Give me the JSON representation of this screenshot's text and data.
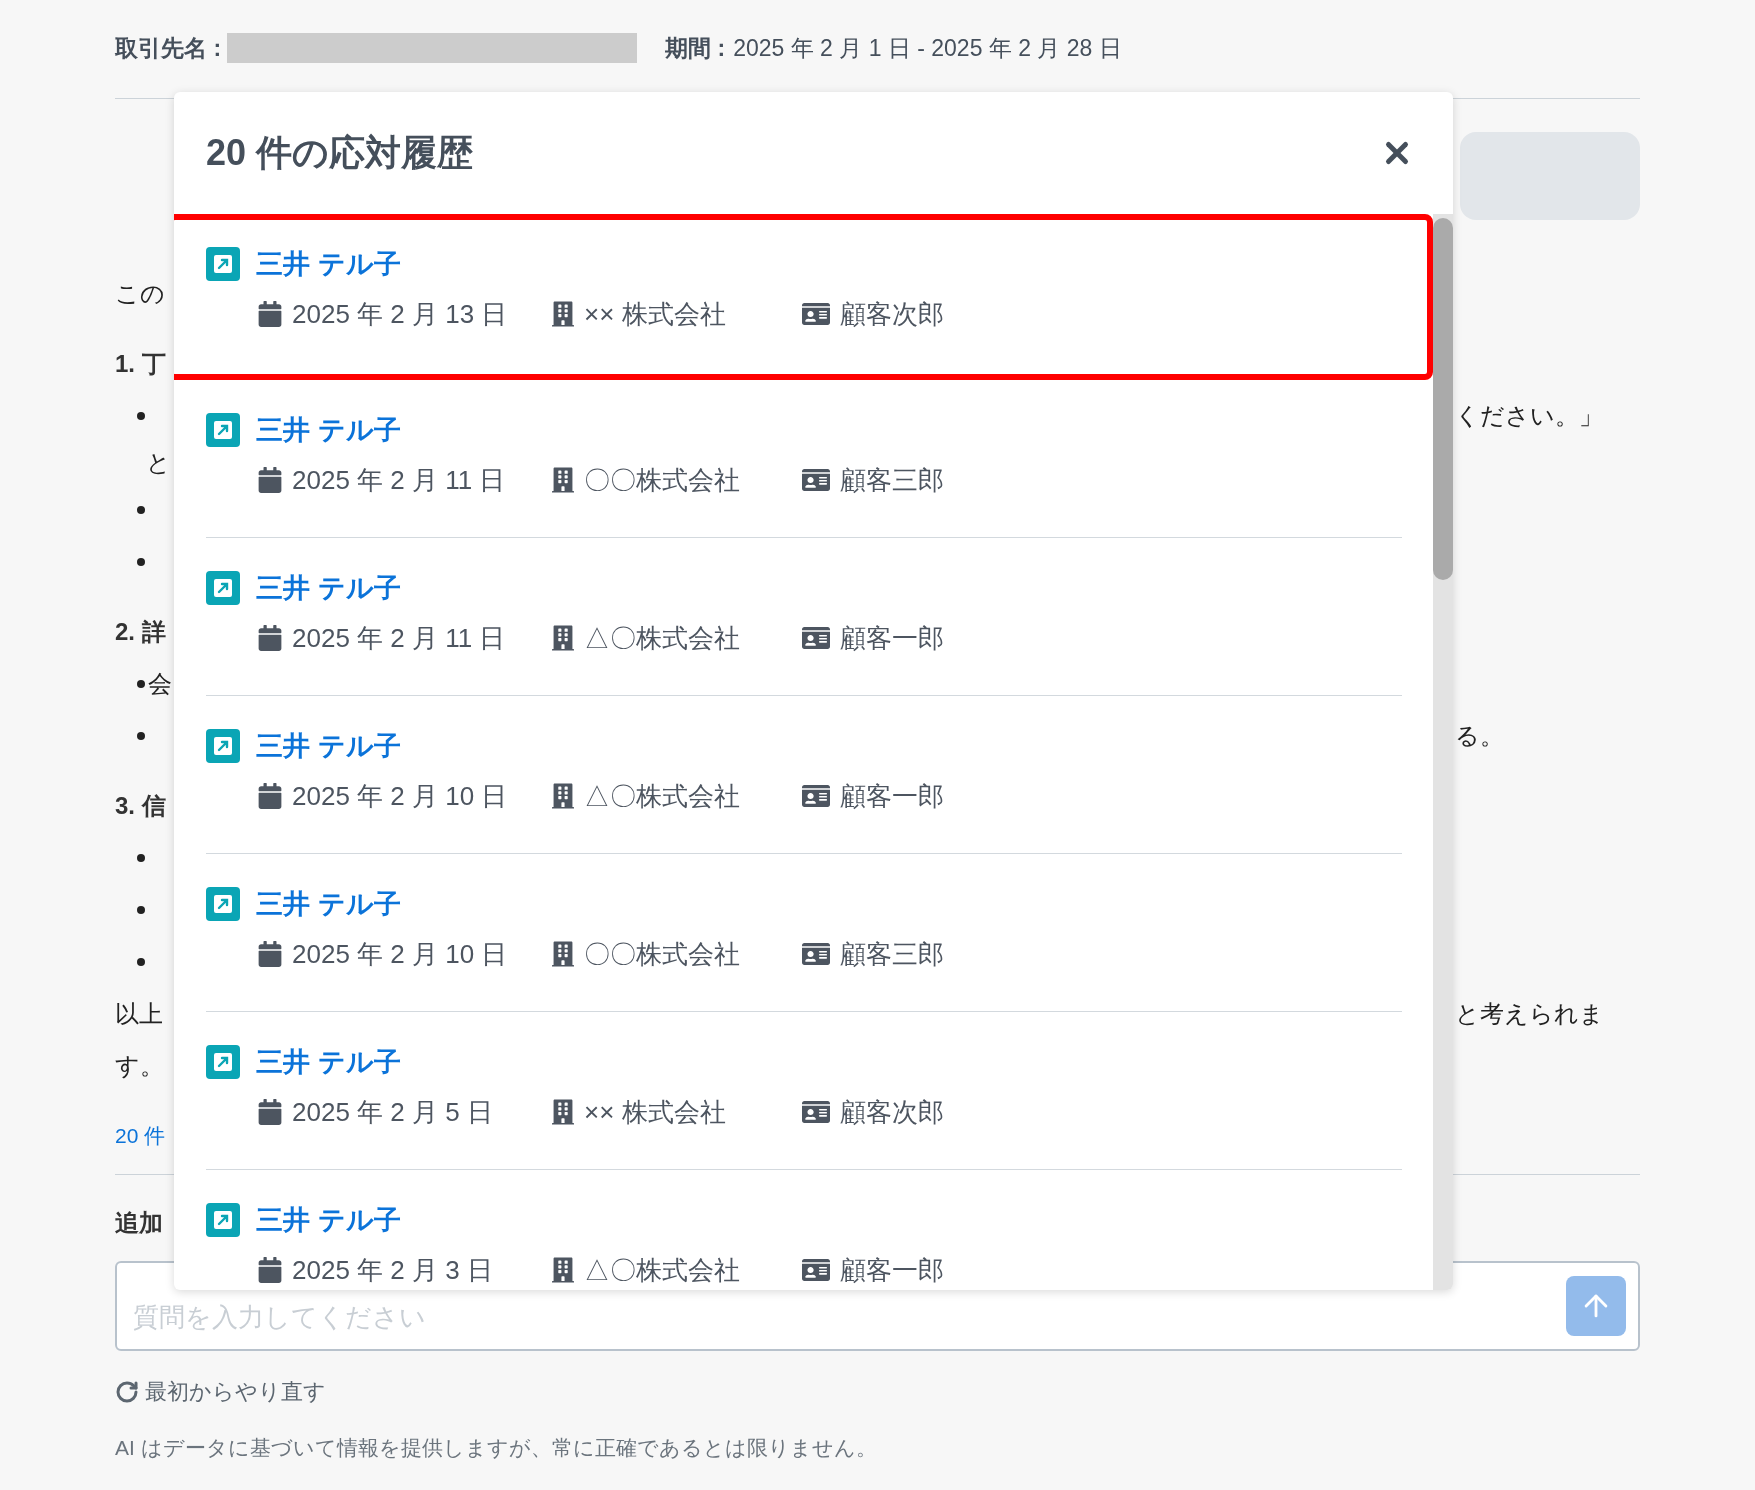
{
  "header": {
    "client_label": "取引先名 :",
    "period_label": "期間 :",
    "period_value": "2025 年 2 月 1 日 - 2025 年 2 月 28 日"
  },
  "fragments": [
    {
      "kind": "text",
      "left": "この"
    },
    {
      "kind": "heading",
      "left": "1. 丁"
    },
    {
      "kind": "bullet",
      "right": "ください。」"
    },
    {
      "kind": "continuation",
      "left": "と"
    },
    {
      "kind": "bullet"
    },
    {
      "kind": "bullet"
    },
    {
      "kind": "heading",
      "left": "2. 詳"
    },
    {
      "kind": "bullet",
      "left": "会"
    },
    {
      "kind": "bullet",
      "right": "る。"
    },
    {
      "kind": "heading",
      "left": "3. 信"
    },
    {
      "kind": "bullet"
    },
    {
      "kind": "bullet"
    },
    {
      "kind": "bullet"
    },
    {
      "kind": "text",
      "left": "以上",
      "right": "と考えられま"
    },
    {
      "kind": "text",
      "left": "す。"
    },
    {
      "kind": "link",
      "left": "20 件"
    }
  ],
  "follow_up": {
    "label": "追加",
    "placeholder": "質問を入力してください"
  },
  "reset": "最初からやり直す",
  "disclaimer": "AI はデータに基づいて情報を提供しますが、常に正確であるとは限りません。",
  "modal": {
    "title": "20 件の応対履歴",
    "items": [
      {
        "name": "三井 テル子",
        "date": "2025 年 2 月 13 日",
        "company": "×× 株式会社",
        "contact": "顧客次郎",
        "highlighted": true
      },
      {
        "name": "三井 テル子",
        "date": "2025 年 2 月 11 日",
        "company": "〇〇株式会社",
        "contact": "顧客三郎",
        "highlighted": false
      },
      {
        "name": "三井 テル子",
        "date": "2025 年 2 月 11 日",
        "company": "△〇株式会社",
        "contact": "顧客一郎",
        "highlighted": false
      },
      {
        "name": "三井 テル子",
        "date": "2025 年 2 月 10 日",
        "company": "△〇株式会社",
        "contact": "顧客一郎",
        "highlighted": false
      },
      {
        "name": "三井 テル子",
        "date": "2025 年 2 月 10 日",
        "company": "〇〇株式会社",
        "contact": "顧客三郎",
        "highlighted": false
      },
      {
        "name": "三井 テル子",
        "date": "2025 年 2 月 5 日",
        "company": "×× 株式会社",
        "contact": "顧客次郎",
        "highlighted": false
      },
      {
        "name": "三井 テル子",
        "date": "2025 年 2 月 3 日",
        "company": "△〇株式会社",
        "contact": "顧客一郎",
        "highlighted": false
      }
    ]
  }
}
